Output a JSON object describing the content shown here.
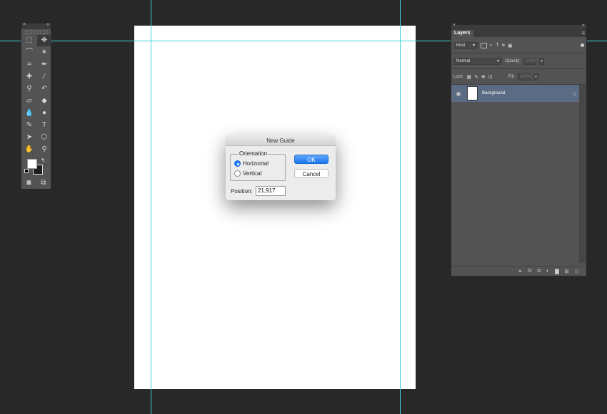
{
  "tools": {
    "close": "×",
    "collapse": "«",
    "items": [
      {
        "name": "marquee",
        "glyph": "⬚"
      },
      {
        "name": "move",
        "glyph": "✥"
      },
      {
        "name": "lasso",
        "glyph": "⌒"
      },
      {
        "name": "magic-wand",
        "glyph": "✶"
      },
      {
        "name": "crop",
        "glyph": "⌗"
      },
      {
        "name": "eyedropper",
        "glyph": "✒"
      },
      {
        "name": "healing",
        "glyph": "✚"
      },
      {
        "name": "brush",
        "glyph": "∕"
      },
      {
        "name": "stamp",
        "glyph": "⚲"
      },
      {
        "name": "history-brush",
        "glyph": "↶"
      },
      {
        "name": "eraser",
        "glyph": "▱"
      },
      {
        "name": "paint-bucket",
        "glyph": "◆"
      },
      {
        "name": "blur",
        "glyph": "💧"
      },
      {
        "name": "dodge",
        "glyph": "●"
      },
      {
        "name": "pen",
        "glyph": "✎"
      },
      {
        "name": "type",
        "glyph": "T"
      },
      {
        "name": "path-select",
        "glyph": "➤"
      },
      {
        "name": "shape",
        "glyph": "⬡"
      },
      {
        "name": "hand",
        "glyph": "✋"
      },
      {
        "name": "zoom",
        "glyph": "⚲"
      }
    ],
    "swap": "↰",
    "quick_mask": "◙",
    "screen_mode": "⧉"
  },
  "layers": {
    "close": "×",
    "collapse": "«",
    "tab": "Layers",
    "menu": "≡",
    "filter": "Kind",
    "blend_mode": "Normal",
    "opacity_label": "Opacity:",
    "opacity_value": "100%",
    "lock_label": "Lock:",
    "fill_label": "Fill:",
    "fill_value": "100%",
    "layer_name": "Background",
    "eye": "◉",
    "lock_icon": "🔒",
    "footer": {
      "link": "⚭",
      "fx": "fx",
      "mask": "◘",
      "adjust": "◐",
      "folder": "▇",
      "new": "⊞",
      "trash": "🗑"
    }
  },
  "dialog": {
    "title": "New Guide",
    "orientation_label": "Orientation",
    "horizontal_label": "Horizontal",
    "vertical_label": "Vertical",
    "selected_orientation": "Horizontal",
    "ok_label": "OK",
    "cancel_label": "Cancel",
    "position_label": "Position:",
    "position_value": "21,917"
  },
  "colors": {
    "workspace": "#282828",
    "panel": "#535353",
    "guide": "#3fd2d8",
    "selected_layer": "#5a6b83",
    "accent": "#1d7cf2"
  }
}
